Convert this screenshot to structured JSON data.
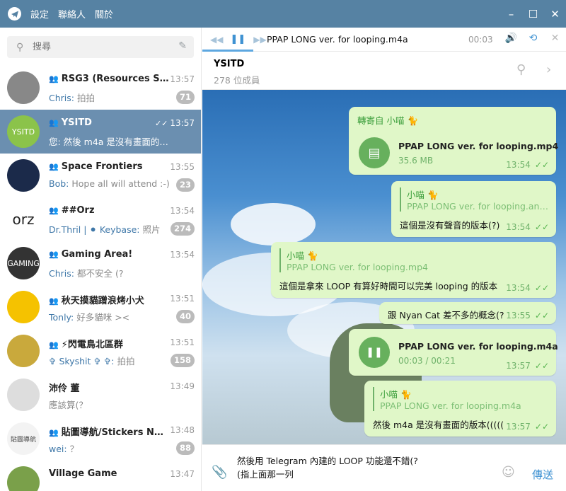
{
  "window": {
    "menu": [
      "設定",
      "聯絡人",
      "關於"
    ],
    "controls": [
      "–",
      "☐",
      "✕"
    ]
  },
  "search": {
    "placeholder": "搜尋"
  },
  "chats": [
    {
      "name": "RSG3 (Resources Shar...",
      "time": "13:57",
      "sender": "Chris:",
      "message": " 拍拍",
      "badge": "71",
      "group": true,
      "avatar_bg": "#888"
    },
    {
      "name": "YSITD",
      "time": "13:57",
      "sender": "",
      "message": "您: 然後 m4a 是沒有畫面的版本(((((",
      "badge": "",
      "group": true,
      "active": true,
      "avatar_text": "YSITD",
      "avatar_bg": "#8bc34a"
    },
    {
      "name": "Space Frontiers",
      "time": "13:55",
      "sender": "Bob:",
      "message": " Hope all will attend :-)",
      "badge": "23",
      "group": true,
      "avatar_bg": "#1b2a4a"
    },
    {
      "name": "##Orz",
      "time": "13:54",
      "sender": "Dr.Thril | ⚫ Keybase:",
      "message": " 照片",
      "badge": "274",
      "group": true,
      "avatar_text": "orz",
      "avatar_bg": "#ffffff"
    },
    {
      "name": "Gaming Area!",
      "time": "13:54",
      "sender": "Chris:",
      "message": " 都不安全 (?",
      "badge": "",
      "group": true,
      "avatar_text": "GAMING",
      "avatar_bg": "#333"
    },
    {
      "name": "秋天摸貓蹭浪烤小犬",
      "time": "13:51",
      "sender": "Tonly:",
      "message": " 好多貓咪 ><",
      "badge": "40",
      "group": true,
      "avatar_bg": "#f5c200"
    },
    {
      "name": "⚡閃電鳥北區群",
      "time": "13:51",
      "sender": "✞ Skyshit ✞ ✞:",
      "message": " 拍拍",
      "badge": "158",
      "group": true,
      "avatar_bg": "#c9a93c"
    },
    {
      "name": "沛伶 董",
      "time": "13:49",
      "sender": "",
      "message": "應該算(？",
      "badge": "",
      "group": false,
      "avatar_bg": "#ddd"
    },
    {
      "name": "貼圖導航/Stickers Navi...",
      "time": "13:48",
      "sender": "wei:",
      "message": " ？",
      "badge": "88",
      "group": true,
      "avatar_text": "貼圖導航",
      "avatar_bg": "#f3f3f3"
    },
    {
      "name": "Village Game",
      "time": "13:47",
      "sender": "",
      "message": "",
      "badge": "",
      "group": false,
      "avatar_bg": "#7aa04a"
    }
  ],
  "player": {
    "title": "PPAP LONG ver. for looping.m4a",
    "time": "00:03",
    "progress": 0.14
  },
  "chat_header": {
    "name": "YSITD",
    "subtitle": "278 位成員"
  },
  "messages": [
    {
      "forward_label": "轉寄自 小喵 🐈",
      "file_name": "PPAP LONG ver. for looping.mp4",
      "file_sub": "35.6 MB",
      "time": "13:54"
    },
    {
      "reply_name": "小喵 🐈",
      "reply_text": "PPAP LONG ver. for looping.an....",
      "text": "這個是沒有聲音的版本(?)",
      "time": "13:54"
    },
    {
      "reply_name": "小喵 🐈",
      "reply_text": "PPAP LONG ver. for looping.mp4",
      "text": "這個是拿來 LOOP 有算好時間可以完美 looping 的版本",
      "time": "13:54"
    },
    {
      "text": "跟 Nyan Cat 差不多的概念(?",
      "time": "13:55"
    },
    {
      "file_name": "PPAP LONG ver. for looping.m4a",
      "file_sub": "00:03 / 00:21",
      "time": "13:57"
    },
    {
      "reply_name": "小喵 🐈",
      "reply_text": "PPAP LONG ver. for looping.m4a",
      "text": "然後 m4a 是沒有畫面的版本(((((",
      "time": "13:57"
    }
  ],
  "compose": {
    "line1": "然後用 Telegram 內建的 LOOP 功能還不錯(?",
    "line2": "(指上面那一列",
    "send_label": "傳送"
  }
}
